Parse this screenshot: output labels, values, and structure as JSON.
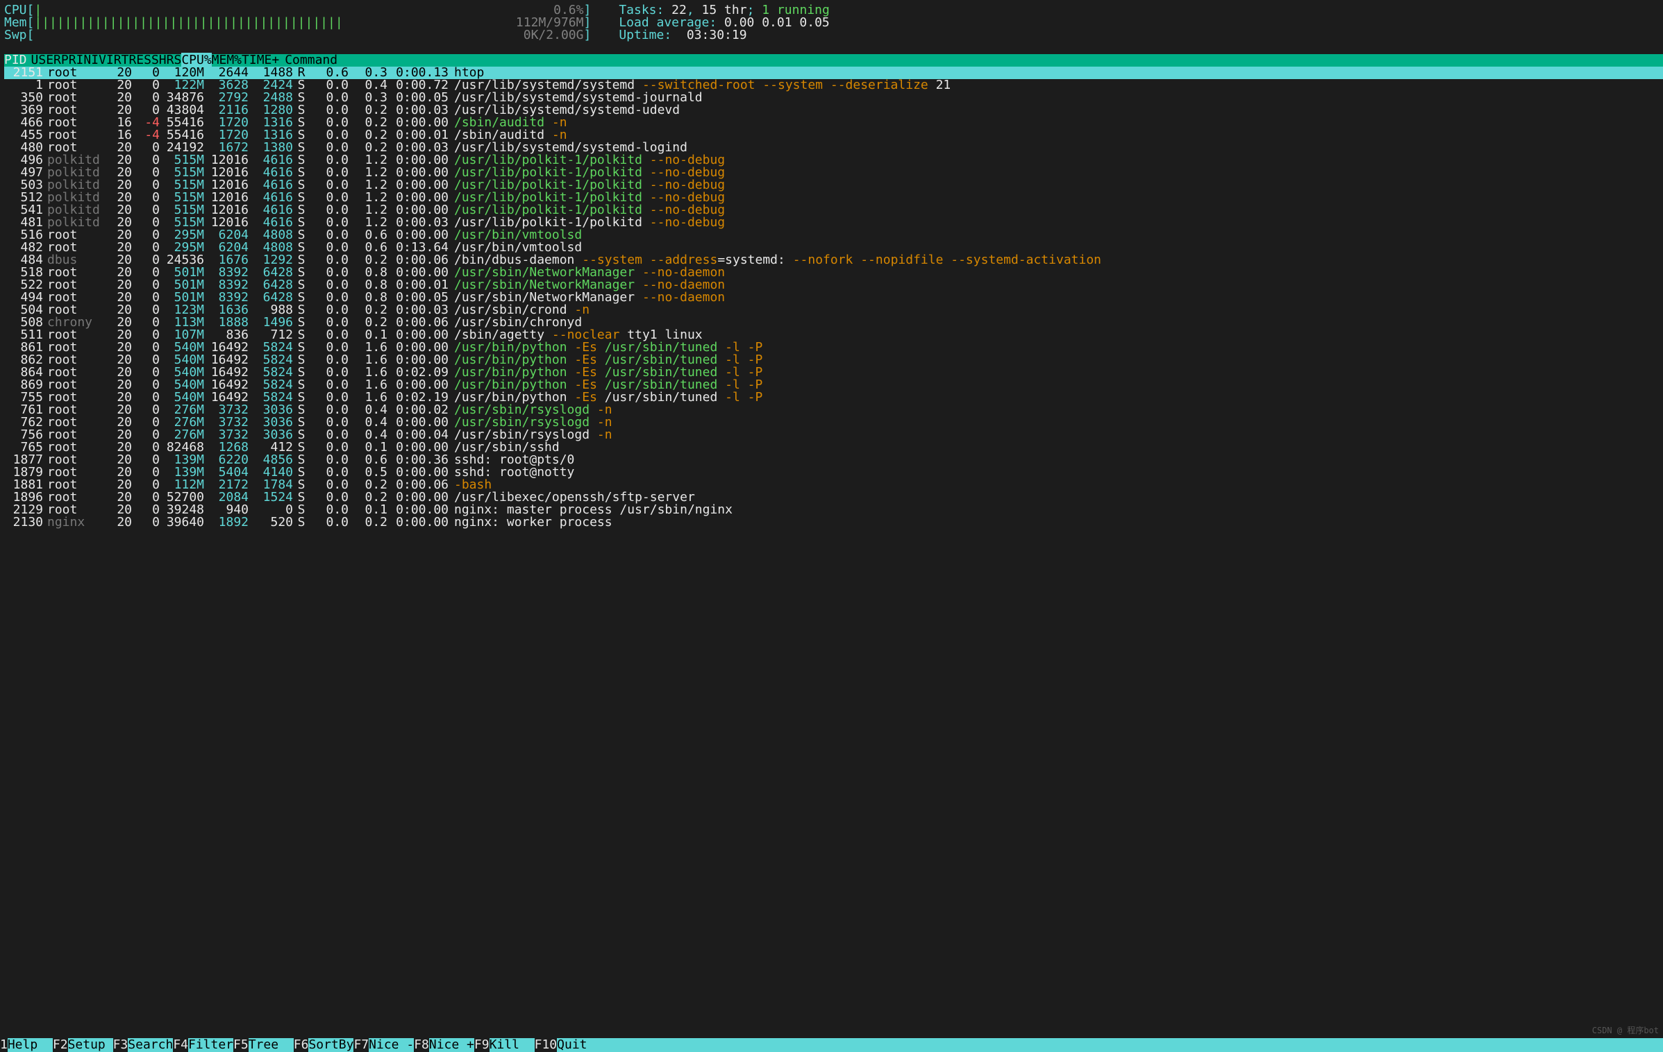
{
  "meters": {
    "cpu": {
      "label": "CPU",
      "bar": "|",
      "value": "0.6%",
      "bar_color": "green"
    },
    "mem": {
      "label": "Mem",
      "bar": "|||||||||||||||||||||||||||||||||||||||||",
      "value": "112M/976M",
      "bar_color": "green"
    },
    "swp": {
      "label": "Swp",
      "bar": "",
      "value": "0K/2.00G"
    }
  },
  "summary": {
    "tasks_label": "Tasks:",
    "tasks": "22",
    "thr": "15 thr",
    "running": "1 running",
    "load_label": "Load average:",
    "load": "0.00 0.01 0.05",
    "uptime_label": "Uptime:",
    "uptime": "03:30:19"
  },
  "headers": {
    "pid": "PID",
    "user": "USER",
    "pri": "PRI",
    "ni": "NI",
    "virt": "VIRT",
    "res": "RES",
    "shr": "SHR",
    "s": "S",
    "cpu": "CPU%",
    "mem": "MEM%",
    "time": "TIME+",
    "cmd": "Command"
  },
  "selected": {
    "pid": "2151",
    "user": "root",
    "pri": "20",
    "ni": "0",
    "virt": "120M",
    "res": "2644",
    "shr": "1488",
    "s": "R",
    "cpu": "0.6",
    "mem": "0.3",
    "time": "0:00.13",
    "cmd": "htop"
  },
  "procs": [
    {
      "pid": "1",
      "user": "root",
      "uc": "white",
      "pri": "20",
      "ni": "0",
      "virt": "122M",
      "vc": "cyan",
      "res": "3628",
      "rc": "cyan",
      "shr": "2424",
      "hc": "cyan",
      "s": "S",
      "cpu": "0.0",
      "mem": "0.4",
      "time": "0:00.72",
      "cmd": [
        {
          "t": "/usr/lib/systemd/systemd ",
          "c": "white"
        },
        {
          "t": "--switched-root --system --deserialize ",
          "c": "orange"
        },
        {
          "t": "21",
          "c": "white"
        }
      ]
    },
    {
      "pid": "350",
      "user": "root",
      "uc": "white",
      "pri": "20",
      "ni": "0",
      "virt": "34876",
      "vc": "white",
      "res": "2792",
      "rc": "cyan",
      "shr": "2488",
      "hc": "cyan",
      "s": "S",
      "cpu": "0.0",
      "mem": "0.3",
      "time": "0:00.05",
      "cmd": [
        {
          "t": "/usr/lib/systemd/systemd-journald",
          "c": "white"
        }
      ]
    },
    {
      "pid": "369",
      "user": "root",
      "uc": "white",
      "pri": "20",
      "ni": "0",
      "virt": "43804",
      "vc": "white",
      "res": "2116",
      "rc": "cyan",
      "shr": "1280",
      "hc": "cyan",
      "s": "S",
      "cpu": "0.0",
      "mem": "0.2",
      "time": "0:00.03",
      "cmd": [
        {
          "t": "/usr/lib/systemd/systemd-udevd",
          "c": "white"
        }
      ]
    },
    {
      "pid": "466",
      "user": "root",
      "uc": "white",
      "pri": "16",
      "ni": "-4",
      "nic": "red",
      "virt": "55416",
      "vc": "white",
      "res": "1720",
      "rc": "cyan",
      "shr": "1316",
      "hc": "cyan",
      "s": "S",
      "cpu": "0.0",
      "mem": "0.2",
      "time": "0:00.00",
      "cmd": [
        {
          "t": "/sbin/auditd ",
          "c": "green"
        },
        {
          "t": "-n",
          "c": "orange"
        }
      ]
    },
    {
      "pid": "455",
      "user": "root",
      "uc": "white",
      "pri": "16",
      "ni": "-4",
      "nic": "red",
      "virt": "55416",
      "vc": "white",
      "res": "1720",
      "rc": "cyan",
      "shr": "1316",
      "hc": "cyan",
      "s": "S",
      "cpu": "0.0",
      "mem": "0.2",
      "time": "0:00.01",
      "cmd": [
        {
          "t": "/sbin/auditd ",
          "c": "white"
        },
        {
          "t": "-n",
          "c": "orange"
        }
      ]
    },
    {
      "pid": "480",
      "user": "root",
      "uc": "white",
      "pri": "20",
      "ni": "0",
      "virt": "24192",
      "vc": "white",
      "res": "1672",
      "rc": "cyan",
      "shr": "1380",
      "hc": "cyan",
      "s": "S",
      "cpu": "0.0",
      "mem": "0.2",
      "time": "0:00.03",
      "cmd": [
        {
          "t": "/usr/lib/systemd/systemd-logind",
          "c": "white"
        }
      ]
    },
    {
      "pid": "496",
      "user": "polkitd",
      "uc": "dim",
      "pri": "20",
      "ni": "0",
      "virt": "515M",
      "vc": "cyan",
      "res": "12016",
      "rc": "white",
      "shr": "4616",
      "hc": "cyan",
      "s": "S",
      "cpu": "0.0",
      "mem": "1.2",
      "time": "0:00.00",
      "cmd": [
        {
          "t": "/usr/lib/polkit-1/polkitd ",
          "c": "green"
        },
        {
          "t": "--no-debug",
          "c": "orange"
        }
      ]
    },
    {
      "pid": "497",
      "user": "polkitd",
      "uc": "dim",
      "pri": "20",
      "ni": "0",
      "virt": "515M",
      "vc": "cyan",
      "res": "12016",
      "rc": "white",
      "shr": "4616",
      "hc": "cyan",
      "s": "S",
      "cpu": "0.0",
      "mem": "1.2",
      "time": "0:00.00",
      "cmd": [
        {
          "t": "/usr/lib/polkit-1/polkitd ",
          "c": "green"
        },
        {
          "t": "--no-debug",
          "c": "orange"
        }
      ]
    },
    {
      "pid": "503",
      "user": "polkitd",
      "uc": "dim",
      "pri": "20",
      "ni": "0",
      "virt": "515M",
      "vc": "cyan",
      "res": "12016",
      "rc": "white",
      "shr": "4616",
      "hc": "cyan",
      "s": "S",
      "cpu": "0.0",
      "mem": "1.2",
      "time": "0:00.00",
      "cmd": [
        {
          "t": "/usr/lib/polkit-1/polkitd ",
          "c": "green"
        },
        {
          "t": "--no-debug",
          "c": "orange"
        }
      ]
    },
    {
      "pid": "512",
      "user": "polkitd",
      "uc": "dim",
      "pri": "20",
      "ni": "0",
      "virt": "515M",
      "vc": "cyan",
      "res": "12016",
      "rc": "white",
      "shr": "4616",
      "hc": "cyan",
      "s": "S",
      "cpu": "0.0",
      "mem": "1.2",
      "time": "0:00.00",
      "cmd": [
        {
          "t": "/usr/lib/polkit-1/polkitd ",
          "c": "green"
        },
        {
          "t": "--no-debug",
          "c": "orange"
        }
      ]
    },
    {
      "pid": "541",
      "user": "polkitd",
      "uc": "dim",
      "pri": "20",
      "ni": "0",
      "virt": "515M",
      "vc": "cyan",
      "res": "12016",
      "rc": "white",
      "shr": "4616",
      "hc": "cyan",
      "s": "S",
      "cpu": "0.0",
      "mem": "1.2",
      "time": "0:00.00",
      "cmd": [
        {
          "t": "/usr/lib/polkit-1/polkitd ",
          "c": "green"
        },
        {
          "t": "--no-debug",
          "c": "orange"
        }
      ]
    },
    {
      "pid": "481",
      "user": "polkitd",
      "uc": "dim",
      "pri": "20",
      "ni": "0",
      "virt": "515M",
      "vc": "cyan",
      "res": "12016",
      "rc": "white",
      "shr": "4616",
      "hc": "cyan",
      "s": "S",
      "cpu": "0.0",
      "mem": "1.2",
      "time": "0:00.03",
      "cmd": [
        {
          "t": "/usr/lib/polkit-1/polkitd ",
          "c": "white"
        },
        {
          "t": "--no-debug",
          "c": "orange"
        }
      ]
    },
    {
      "pid": "516",
      "user": "root",
      "uc": "white",
      "pri": "20",
      "ni": "0",
      "virt": "295M",
      "vc": "cyan",
      "res": "6204",
      "rc": "cyan",
      "shr": "4808",
      "hc": "cyan",
      "s": "S",
      "cpu": "0.0",
      "mem": "0.6",
      "time": "0:00.00",
      "cmd": [
        {
          "t": "/usr/bin/vmtoolsd",
          "c": "green"
        }
      ]
    },
    {
      "pid": "482",
      "user": "root",
      "uc": "white",
      "pri": "20",
      "ni": "0",
      "virt": "295M",
      "vc": "cyan",
      "res": "6204",
      "rc": "cyan",
      "shr": "4808",
      "hc": "cyan",
      "s": "S",
      "cpu": "0.0",
      "mem": "0.6",
      "time": "0:13.64",
      "cmd": [
        {
          "t": "/usr/bin/vmtoolsd",
          "c": "white"
        }
      ]
    },
    {
      "pid": "484",
      "user": "dbus",
      "uc": "dim",
      "pri": "20",
      "ni": "0",
      "virt": "24536",
      "vc": "white",
      "res": "1676",
      "rc": "cyan",
      "shr": "1292",
      "hc": "cyan",
      "s": "S",
      "cpu": "0.0",
      "mem": "0.2",
      "time": "0:00.06",
      "cmd": [
        {
          "t": "/bin/dbus-daemon ",
          "c": "white"
        },
        {
          "t": "--system --address",
          "c": "orange"
        },
        {
          "t": "=systemd: ",
          "c": "white"
        },
        {
          "t": "--nofork --nopidfile --systemd-activation",
          "c": "orange"
        }
      ]
    },
    {
      "pid": "518",
      "user": "root",
      "uc": "white",
      "pri": "20",
      "ni": "0",
      "virt": "501M",
      "vc": "cyan",
      "res": "8392",
      "rc": "cyan",
      "shr": "6428",
      "hc": "cyan",
      "s": "S",
      "cpu": "0.0",
      "mem": "0.8",
      "time": "0:00.00",
      "cmd": [
        {
          "t": "/usr/sbin/NetworkManager ",
          "c": "green"
        },
        {
          "t": "--no-daemon",
          "c": "orange"
        }
      ]
    },
    {
      "pid": "522",
      "user": "root",
      "uc": "white",
      "pri": "20",
      "ni": "0",
      "virt": "501M",
      "vc": "cyan",
      "res": "8392",
      "rc": "cyan",
      "shr": "6428",
      "hc": "cyan",
      "s": "S",
      "cpu": "0.0",
      "mem": "0.8",
      "time": "0:00.01",
      "cmd": [
        {
          "t": "/usr/sbin/NetworkManager ",
          "c": "green"
        },
        {
          "t": "--no-daemon",
          "c": "orange"
        }
      ]
    },
    {
      "pid": "494",
      "user": "root",
      "uc": "white",
      "pri": "20",
      "ni": "0",
      "virt": "501M",
      "vc": "cyan",
      "res": "8392",
      "rc": "cyan",
      "shr": "6428",
      "hc": "cyan",
      "s": "S",
      "cpu": "0.0",
      "mem": "0.8",
      "time": "0:00.05",
      "cmd": [
        {
          "t": "/usr/sbin/NetworkManager ",
          "c": "white"
        },
        {
          "t": "--no-daemon",
          "c": "orange"
        }
      ]
    },
    {
      "pid": "504",
      "user": "root",
      "uc": "white",
      "pri": "20",
      "ni": "0",
      "virt": "123M",
      "vc": "cyan",
      "res": "1636",
      "rc": "cyan",
      "shr": "988",
      "hc": "white",
      "s": "S",
      "cpu": "0.0",
      "mem": "0.2",
      "time": "0:00.03",
      "cmd": [
        {
          "t": "/usr/sbin/crond ",
          "c": "white"
        },
        {
          "t": "-n",
          "c": "orange"
        }
      ]
    },
    {
      "pid": "508",
      "user": "chrony",
      "uc": "dim",
      "pri": "20",
      "ni": "0",
      "virt": "113M",
      "vc": "cyan",
      "res": "1888",
      "rc": "cyan",
      "shr": "1496",
      "hc": "cyan",
      "s": "S",
      "cpu": "0.0",
      "mem": "0.2",
      "time": "0:00.06",
      "cmd": [
        {
          "t": "/usr/sbin/chronyd",
          "c": "white"
        }
      ]
    },
    {
      "pid": "511",
      "user": "root",
      "uc": "white",
      "pri": "20",
      "ni": "0",
      "virt": "107M",
      "vc": "cyan",
      "res": "836",
      "rc": "white",
      "shr": "712",
      "hc": "white",
      "s": "S",
      "cpu": "0.0",
      "mem": "0.1",
      "time": "0:00.00",
      "cmd": [
        {
          "t": "/sbin/agetty ",
          "c": "white"
        },
        {
          "t": "--noclear ",
          "c": "orange"
        },
        {
          "t": "tty1 linux",
          "c": "white"
        }
      ]
    },
    {
      "pid": "861",
      "user": "root",
      "uc": "white",
      "pri": "20",
      "ni": "0",
      "virt": "540M",
      "vc": "cyan",
      "res": "16492",
      "rc": "white",
      "shr": "5824",
      "hc": "cyan",
      "s": "S",
      "cpu": "0.0",
      "mem": "1.6",
      "time": "0:00.00",
      "cmd": [
        {
          "t": "/usr/bin/python ",
          "c": "green"
        },
        {
          "t": "-Es ",
          "c": "orange"
        },
        {
          "t": "/usr/sbin/tuned ",
          "c": "green"
        },
        {
          "t": "-l -P",
          "c": "orange"
        }
      ]
    },
    {
      "pid": "862",
      "user": "root",
      "uc": "white",
      "pri": "20",
      "ni": "0",
      "virt": "540M",
      "vc": "cyan",
      "res": "16492",
      "rc": "white",
      "shr": "5824",
      "hc": "cyan",
      "s": "S",
      "cpu": "0.0",
      "mem": "1.6",
      "time": "0:00.00",
      "cmd": [
        {
          "t": "/usr/bin/python ",
          "c": "green"
        },
        {
          "t": "-Es ",
          "c": "orange"
        },
        {
          "t": "/usr/sbin/tuned ",
          "c": "green"
        },
        {
          "t": "-l -P",
          "c": "orange"
        }
      ]
    },
    {
      "pid": "864",
      "user": "root",
      "uc": "white",
      "pri": "20",
      "ni": "0",
      "virt": "540M",
      "vc": "cyan",
      "res": "16492",
      "rc": "white",
      "shr": "5824",
      "hc": "cyan",
      "s": "S",
      "cpu": "0.0",
      "mem": "1.6",
      "time": "0:02.09",
      "cmd": [
        {
          "t": "/usr/bin/python ",
          "c": "green"
        },
        {
          "t": "-Es ",
          "c": "orange"
        },
        {
          "t": "/usr/sbin/tuned ",
          "c": "green"
        },
        {
          "t": "-l -P",
          "c": "orange"
        }
      ]
    },
    {
      "pid": "869",
      "user": "root",
      "uc": "white",
      "pri": "20",
      "ni": "0",
      "virt": "540M",
      "vc": "cyan",
      "res": "16492",
      "rc": "white",
      "shr": "5824",
      "hc": "cyan",
      "s": "S",
      "cpu": "0.0",
      "mem": "1.6",
      "time": "0:00.00",
      "cmd": [
        {
          "t": "/usr/bin/python ",
          "c": "green"
        },
        {
          "t": "-Es ",
          "c": "orange"
        },
        {
          "t": "/usr/sbin/tuned ",
          "c": "green"
        },
        {
          "t": "-l -P",
          "c": "orange"
        }
      ]
    },
    {
      "pid": "755",
      "user": "root",
      "uc": "white",
      "pri": "20",
      "ni": "0",
      "virt": "540M",
      "vc": "cyan",
      "res": "16492",
      "rc": "white",
      "shr": "5824",
      "hc": "cyan",
      "s": "S",
      "cpu": "0.0",
      "mem": "1.6",
      "time": "0:02.19",
      "cmd": [
        {
          "t": "/usr/bin/python ",
          "c": "white"
        },
        {
          "t": "-Es ",
          "c": "orange"
        },
        {
          "t": "/usr/sbin/tuned ",
          "c": "white"
        },
        {
          "t": "-l -P",
          "c": "orange"
        }
      ]
    },
    {
      "pid": "761",
      "user": "root",
      "uc": "white",
      "pri": "20",
      "ni": "0",
      "virt": "276M",
      "vc": "cyan",
      "res": "3732",
      "rc": "cyan",
      "shr": "3036",
      "hc": "cyan",
      "s": "S",
      "cpu": "0.0",
      "mem": "0.4",
      "time": "0:00.02",
      "cmd": [
        {
          "t": "/usr/sbin/rsyslogd ",
          "c": "green"
        },
        {
          "t": "-n",
          "c": "orange"
        }
      ]
    },
    {
      "pid": "762",
      "user": "root",
      "uc": "white",
      "pri": "20",
      "ni": "0",
      "virt": "276M",
      "vc": "cyan",
      "res": "3732",
      "rc": "cyan",
      "shr": "3036",
      "hc": "cyan",
      "s": "S",
      "cpu": "0.0",
      "mem": "0.4",
      "time": "0:00.00",
      "cmd": [
        {
          "t": "/usr/sbin/rsyslogd ",
          "c": "green"
        },
        {
          "t": "-n",
          "c": "orange"
        }
      ]
    },
    {
      "pid": "756",
      "user": "root",
      "uc": "white",
      "pri": "20",
      "ni": "0",
      "virt": "276M",
      "vc": "cyan",
      "res": "3732",
      "rc": "cyan",
      "shr": "3036",
      "hc": "cyan",
      "s": "S",
      "cpu": "0.0",
      "mem": "0.4",
      "time": "0:00.04",
      "cmd": [
        {
          "t": "/usr/sbin/rsyslogd ",
          "c": "white"
        },
        {
          "t": "-n",
          "c": "orange"
        }
      ]
    },
    {
      "pid": "765",
      "user": "root",
      "uc": "white",
      "pri": "20",
      "ni": "0",
      "virt": "82468",
      "vc": "white",
      "res": "1268",
      "rc": "cyan",
      "shr": "412",
      "hc": "white",
      "s": "S",
      "cpu": "0.0",
      "mem": "0.1",
      "time": "0:00.00",
      "cmd": [
        {
          "t": "/usr/sbin/sshd",
          "c": "white"
        }
      ]
    },
    {
      "pid": "1877",
      "user": "root",
      "uc": "white",
      "pri": "20",
      "ni": "0",
      "virt": "139M",
      "vc": "cyan",
      "res": "6220",
      "rc": "cyan",
      "shr": "4856",
      "hc": "cyan",
      "s": "S",
      "cpu": "0.0",
      "mem": "0.6",
      "time": "0:00.36",
      "cmd": [
        {
          "t": "sshd: root@pts/0",
          "c": "white"
        }
      ]
    },
    {
      "pid": "1879",
      "user": "root",
      "uc": "white",
      "pri": "20",
      "ni": "0",
      "virt": "139M",
      "vc": "cyan",
      "res": "5404",
      "rc": "cyan",
      "shr": "4140",
      "hc": "cyan",
      "s": "S",
      "cpu": "0.0",
      "mem": "0.5",
      "time": "0:00.00",
      "cmd": [
        {
          "t": "sshd: root@notty",
          "c": "white"
        }
      ]
    },
    {
      "pid": "1881",
      "user": "root",
      "uc": "white",
      "pri": "20",
      "ni": "0",
      "virt": "112M",
      "vc": "cyan",
      "res": "2172",
      "rc": "cyan",
      "shr": "1784",
      "hc": "cyan",
      "s": "S",
      "cpu": "0.0",
      "mem": "0.2",
      "time": "0:00.06",
      "cmd": [
        {
          "t": "-bash",
          "c": "orange"
        }
      ]
    },
    {
      "pid": "1896",
      "user": "root",
      "uc": "white",
      "pri": "20",
      "ni": "0",
      "virt": "52700",
      "vc": "white",
      "res": "2084",
      "rc": "cyan",
      "shr": "1524",
      "hc": "cyan",
      "s": "S",
      "cpu": "0.0",
      "mem": "0.2",
      "time": "0:00.00",
      "cmd": [
        {
          "t": "/usr/libexec/openssh/sftp-server",
          "c": "white"
        }
      ]
    },
    {
      "pid": "2129",
      "user": "root",
      "uc": "white",
      "pri": "20",
      "ni": "0",
      "virt": "39248",
      "vc": "white",
      "res": "940",
      "rc": "white",
      "shr": "0",
      "hc": "white",
      "s": "S",
      "cpu": "0.0",
      "mem": "0.1",
      "time": "0:00.00",
      "cmd": [
        {
          "t": "nginx: master process /usr/sbin/nginx",
          "c": "white"
        }
      ]
    },
    {
      "pid": "2130",
      "user": "nginx",
      "uc": "dim",
      "pri": "20",
      "ni": "0",
      "virt": "39640",
      "vc": "white",
      "res": "1892",
      "rc": "cyan",
      "shr": "520",
      "hc": "white",
      "s": "S",
      "cpu": "0.0",
      "mem": "0.2",
      "time": "0:00.00",
      "cmd": [
        {
          "t": "nginx: worker process",
          "c": "white"
        }
      ]
    }
  ],
  "footer": [
    {
      "k": "1",
      "l": "Help  "
    },
    {
      "k": "F2",
      "l": "Setup "
    },
    {
      "k": "F3",
      "l": "Search"
    },
    {
      "k": "F4",
      "l": "Filter"
    },
    {
      "k": "F5",
      "l": "Tree  "
    },
    {
      "k": "F6",
      "l": "SortBy"
    },
    {
      "k": "F7",
      "l": "Nice -"
    },
    {
      "k": "F8",
      "l": "Nice +"
    },
    {
      "k": "F9",
      "l": "Kill  "
    },
    {
      "k": "F10",
      "l": "Quit"
    }
  ],
  "watermark": "CSDN @ 程序bot"
}
